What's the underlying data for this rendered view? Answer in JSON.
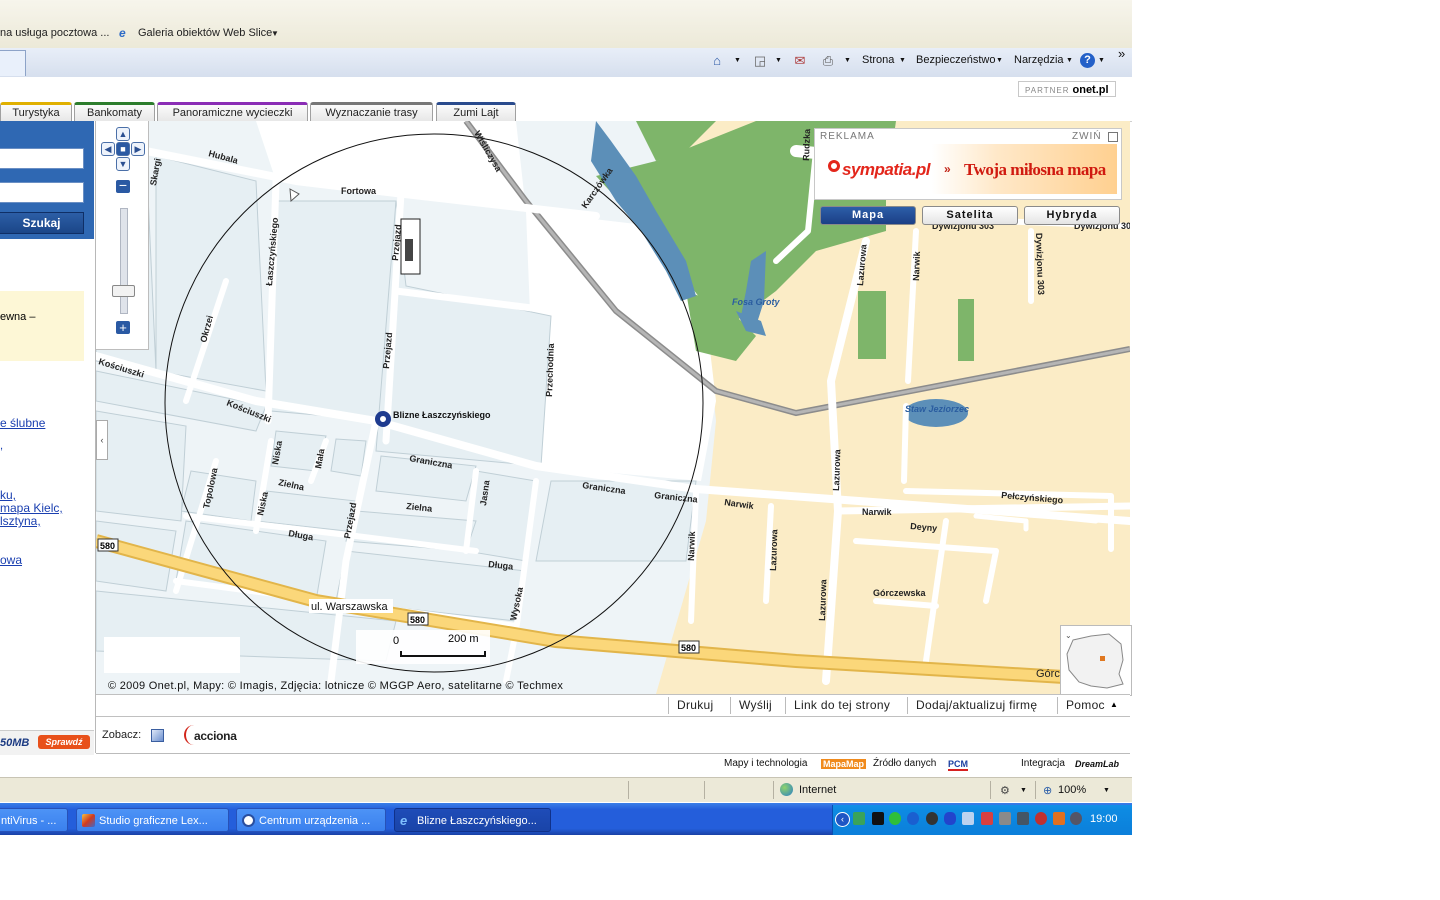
{
  "favorites": {
    "item1": "na usługa pocztowa ...",
    "item2": "Galeria obiektów Web Slice"
  },
  "commandbar": {
    "strona": "Strona",
    "bezpieczenstwo": "Bezpieczeństwo",
    "narzedzia": "Narzędzia",
    "overflow": "»"
  },
  "partner": {
    "label": "PARTNER",
    "brand": "onet.pl"
  },
  "page_tabs": [
    {
      "label": "Turystyka",
      "color": "#e0b000"
    },
    {
      "label": "Bankomaty",
      "color": "#2d7d2d"
    },
    {
      "label": "Panoramiczne wycieczki",
      "color": "#8a2db5"
    },
    {
      "label": "Wyznaczanie trasy",
      "color": "#777777"
    },
    {
      "label": "Zumi Lajt",
      "color": "#2a4b8d"
    }
  ],
  "left": {
    "search_button": "Szukaj",
    "yellow_text": "ewna –",
    "links": [
      "e ślubne",
      "ku,",
      "mapa Kielc,",
      "lsztyna,",
      "owa"
    ],
    "bottom_text": "50MB",
    "bottom_button": "Sprawdź"
  },
  "map": {
    "streets": [
      "Hubala",
      "Fortowa",
      "Wiśliczysa",
      "Karczówka",
      "Łaszczyńskiego",
      "Przejazd",
      "Okrzei",
      "Kościuszki",
      "Kościuszki",
      "Przejazd",
      "Przechodnia",
      "Niska",
      "Mała",
      "Graniczna",
      "Graniczna",
      "Graniczna",
      "Zielna",
      "Zielna",
      "Jasna",
      "Topolowa",
      "Niska",
      "Długa",
      "Przejazd",
      "Długa",
      "Wysoka",
      "Narwik",
      "Narwik",
      "Narwik",
      "Lazurowa",
      "Lazurowa",
      "Lazurowa",
      "Lazurowa",
      "Narwik",
      "Dywizjonu 303",
      "Dywizjonu 303",
      "Dywizjonu 303",
      "Pełczyńskiego",
      "Deyny",
      "Górczewska",
      "Górc",
      "Skargi",
      "Rudzka"
    ],
    "water_labels": [
      "Fosa Groty",
      "Staw Jeziorzec"
    ],
    "poi_label": "Blizne Łaszczyńskiego",
    "road_label": "ul. Warszawska",
    "road_numbers": [
      "580",
      "580",
      "580",
      "580"
    ],
    "scale": {
      "zero": "0",
      "distance": "200 m"
    },
    "copyright": "© 2009 Onet.pl, Mapy: © Imagis, Zdjęcia: lotnicze © MGGP Aero, satelitarne © Techmex"
  },
  "ad": {
    "label": "REKLAMA",
    "zwin": "ZWIŃ",
    "logo": "sympatia.pl",
    "slogan": "Twoja miłosna mapa"
  },
  "map_types": [
    "Mapa",
    "Satelita",
    "Hybryda"
  ],
  "map_tools": [
    "Drukuj",
    "Wyślij",
    "Link do tej strony",
    "Dodaj/aktualizuj firmę",
    "Pomoc"
  ],
  "zobacz": {
    "label": "Zobacz:",
    "partner": "acciona"
  },
  "credits": {
    "mapy": "Mapy i technologia",
    "mapy_logo": "MapaMap",
    "zrodlo": "Źródło danych",
    "zrodlo_logo": "PCM",
    "integracja": "Integracja",
    "integracja_logo": "DreamLab"
  },
  "statusbar": {
    "zone": "Internet",
    "zoom": "100%"
  },
  "taskbar": {
    "tasks": [
      "ntiVirus - ...",
      "Studio graficzne Lex...",
      "Centrum urządzenia ...",
      "Blizne Łaszczyńskiego..."
    ],
    "clock": "19:00"
  }
}
